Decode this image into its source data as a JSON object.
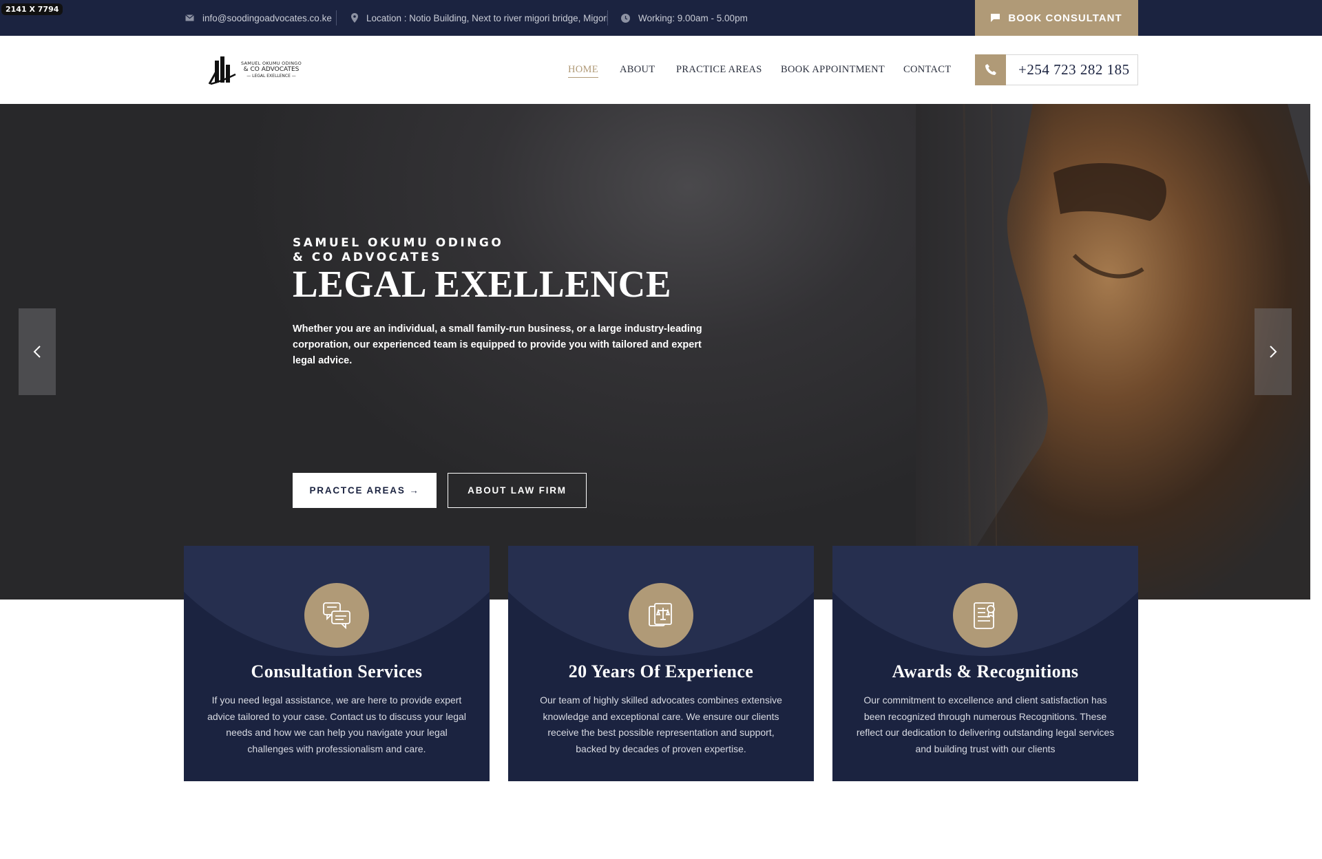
{
  "badge": "2141 X 7794",
  "topbar": {
    "email": "info@soodingoadvocates.co.ke",
    "location": "Location : Notio Building, Next to river migori bridge, Migori",
    "hours": "Working: 9.00am - 5.00pm",
    "book_label": "BOOK CONSULTANT"
  },
  "logo": {
    "line1": "SAMUEL OKUMU ODINGO",
    "line2": "& CO ADVOCATES",
    "line3": "— LEGAL EXELLENCE —"
  },
  "nav": {
    "items": [
      {
        "label": "HOME",
        "active": true
      },
      {
        "label": "ABOUT"
      },
      {
        "label": "PRACTICE AREAS"
      },
      {
        "label": "BOOK APPOINTMENT"
      },
      {
        "label": "CONTACT"
      }
    ],
    "phone": "+254 723 282 185"
  },
  "hero": {
    "subtitle_line1": "SAMUEL OKUMU ODINGO",
    "subtitle_line2": "& CO ADVOCATES",
    "title": "LEGAL EXELLENCE",
    "description": "Whether you are an individual, a small family-run business, or a large industry-leading corporation, our experienced team is equipped to provide you with tailored and expert legal advice.",
    "primary_button": "PRACTCE AREAS →",
    "secondary_button": "ABOUT LAW FIRM"
  },
  "cards": [
    {
      "icon": "chat-bubbles-icon",
      "title": "Consultation Services",
      "text": "If you need legal assistance, we are here to provide expert advice tailored to your case. Contact us to discuss your legal needs and how we can help you navigate your legal challenges with professionalism and care."
    },
    {
      "icon": "legal-documents-icon",
      "title": "20 Years Of Experience",
      "text": "Our team of highly skilled advocates combines extensive knowledge and exceptional care. We ensure our clients receive the best possible representation and support, backed by decades of proven expertise."
    },
    {
      "icon": "certificate-award-icon",
      "title": "Awards & Recognitions",
      "text": "Our commitment to excellence and client satisfaction has been recognized through numerous Recognitions. These reflect our dedication to delivering outstanding legal services and building trust with our clients"
    }
  ],
  "colors": {
    "navy": "#1b2340",
    "gold": "#b09a77"
  }
}
